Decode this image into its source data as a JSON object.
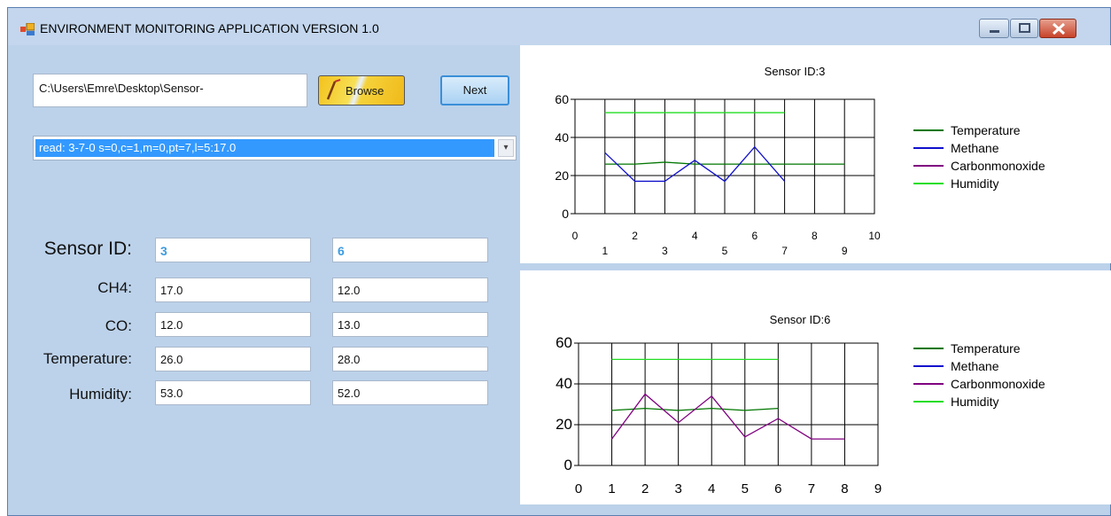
{
  "window": {
    "title": "ENVIRONMENT MONITORING APPLICATION VERSION 1.0"
  },
  "file": {
    "path": "C:\\Users\\Emre\\Desktop\\Sensor-",
    "browse_label": "Browse",
    "next_label": "Next"
  },
  "log": {
    "selected_line": "read: 3-7-0 s=0,c=1,m=0,pt=7,l=5:17.0"
  },
  "labels": {
    "sensor_id": "Sensor ID:",
    "ch4": "CH4:",
    "co": "CO:",
    "temperature": "Temperature:",
    "humidity": "Humidity:"
  },
  "sensor_a": {
    "id": "3",
    "ch4": "17.0",
    "co": "12.0",
    "temperature": "26.0",
    "humidity": "53.0"
  },
  "sensor_b": {
    "id": "6",
    "ch4": "12.0",
    "co": "13.0",
    "temperature": "28.0",
    "humidity": "52.0"
  },
  "chart_data": [
    {
      "type": "line",
      "title": "Sensor ID:3",
      "xlim": [
        0,
        10
      ],
      "ylim": [
        0,
        60
      ],
      "x_ticks_top": [
        "0",
        "2",
        "4",
        "6",
        "8",
        "10"
      ],
      "x_ticks_bottom": [
        "1",
        "3",
        "5",
        "7",
        "9"
      ],
      "y_ticks": [
        "0",
        "20",
        "40",
        "60"
      ],
      "grid": true,
      "legend_position": "top-right",
      "series": [
        {
          "name": "Temperature",
          "color": "#007700",
          "x": [
            1,
            2,
            3,
            4,
            5,
            6,
            7,
            8,
            9
          ],
          "values": [
            26,
            26,
            27,
            26,
            26,
            26,
            26,
            26,
            26
          ]
        },
        {
          "name": "Methane",
          "color": "#1010cc",
          "x": [
            1,
            2,
            3,
            4,
            5,
            6,
            7
          ],
          "values": [
            32,
            17,
            17,
            28,
            17,
            35,
            17
          ]
        },
        {
          "name": "Carbonmonoxide",
          "color": "#800080",
          "x": [],
          "values": []
        },
        {
          "name": "Humidity",
          "color": "#22dd22",
          "x": [
            1,
            2,
            3,
            4,
            5,
            6,
            7
          ],
          "values": [
            53,
            53,
            53,
            53,
            53,
            53,
            53
          ]
        }
      ]
    },
    {
      "type": "line",
      "title": "Sensor ID:6",
      "xlim": [
        0,
        9
      ],
      "ylim": [
        0,
        60
      ],
      "x_ticks": [
        "0",
        "1",
        "2",
        "3",
        "4",
        "5",
        "6",
        "7",
        "8",
        "9"
      ],
      "y_ticks": [
        "0",
        "20",
        "40",
        "60"
      ],
      "grid": true,
      "legend_position": "top-right",
      "series": [
        {
          "name": "Temperature",
          "color": "#007700",
          "x": [
            1,
            2,
            3,
            4,
            5,
            6
          ],
          "values": [
            27,
            28,
            27,
            28,
            27,
            28
          ]
        },
        {
          "name": "Methane",
          "color": "#1010cc",
          "x": [],
          "values": []
        },
        {
          "name": "Carbonmonoxide",
          "color": "#800080",
          "x": [
            1,
            2,
            3,
            4,
            5,
            6,
            7,
            8
          ],
          "values": [
            13,
            35,
            21,
            34,
            14,
            23,
            13,
            13
          ]
        },
        {
          "name": "Humidity",
          "color": "#22dd22",
          "x": [
            1,
            2,
            3,
            4,
            5,
            6
          ],
          "values": [
            52,
            52,
            52,
            52,
            52,
            52
          ]
        }
      ]
    }
  ]
}
